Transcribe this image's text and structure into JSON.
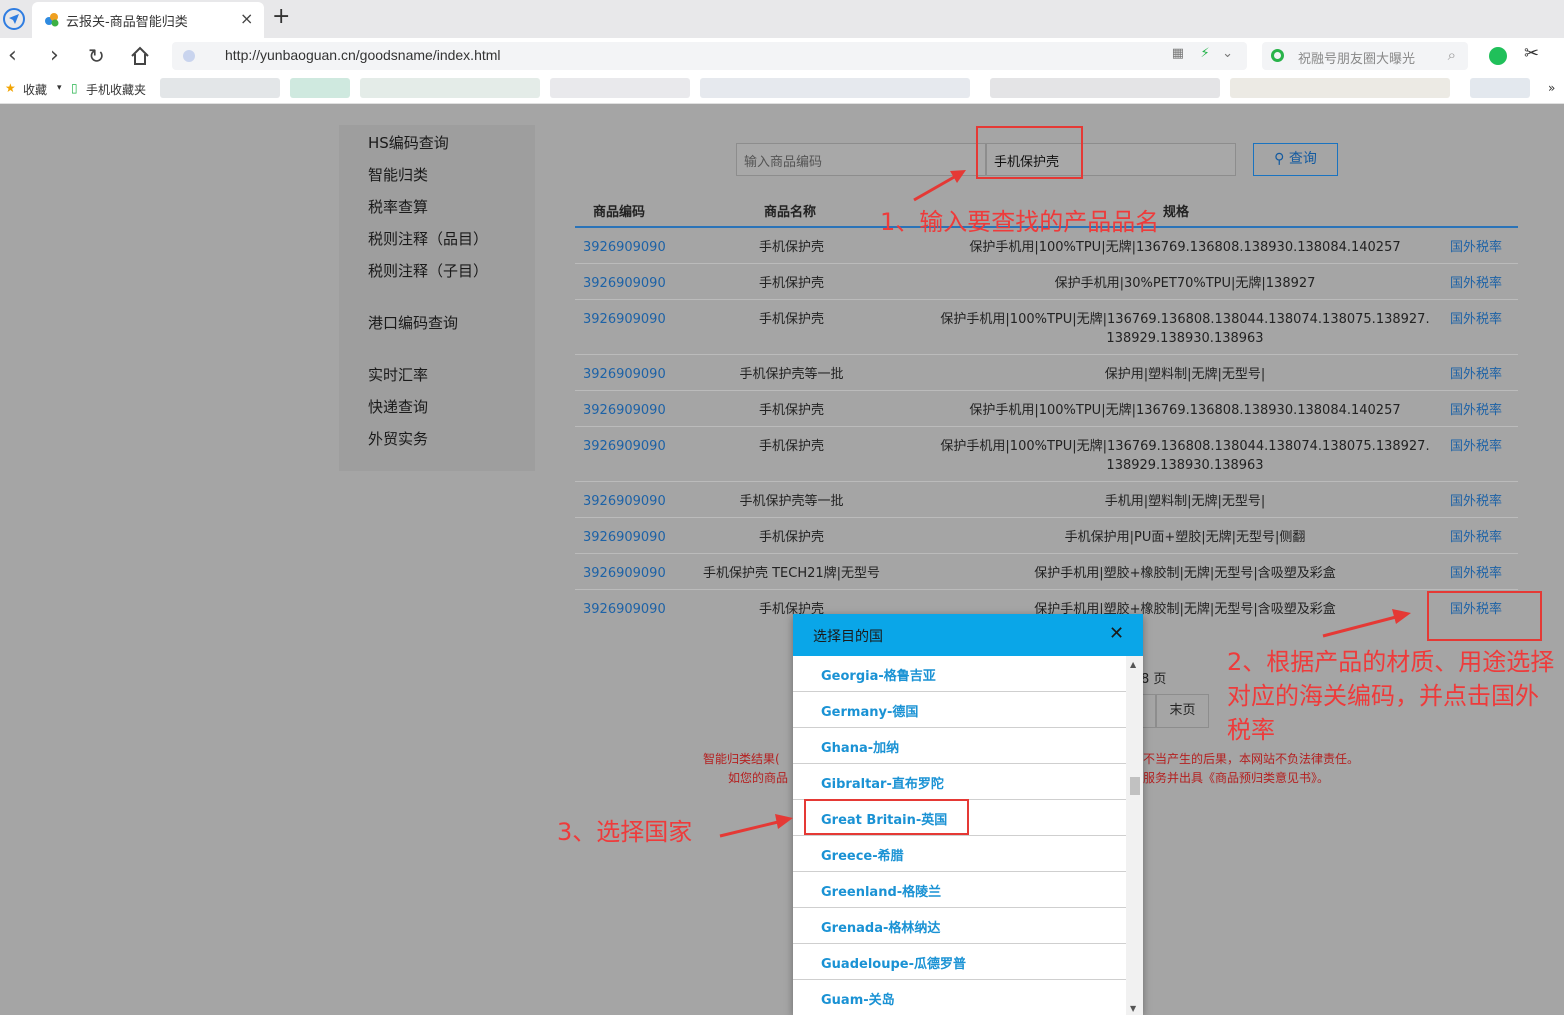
{
  "browser": {
    "tab_title": "云报关-商品智能归类",
    "tab_close": "×",
    "new_tab": "+",
    "url": "http://yunbaoguan.cn/goodsname/index.html",
    "search_placeholder": "祝融号朋友圈大曝光",
    "bookmarks": [
      {
        "label": "收藏"
      },
      {
        "label": "手机收藏夹"
      }
    ],
    "icons": [
      "back-icon",
      "forward-icon",
      "reload-icon",
      "home-icon",
      "shield-icon",
      "qr-icon",
      "lightning-icon",
      "chevron-down-icon",
      "search-icon",
      "extension-icon",
      "scissors-icon"
    ]
  },
  "sidebar": {
    "items": [
      {
        "label": "HS编码查询"
      },
      {
        "label": "智能归类"
      },
      {
        "label": "税率查算"
      },
      {
        "label": "税则注释（品目）"
      },
      {
        "label": "税则注释（子目）"
      },
      {
        "label": "港口编码查询"
      },
      {
        "label": "实时汇率"
      },
      {
        "label": "快递查询"
      },
      {
        "label": "外贸实务"
      }
    ]
  },
  "search": {
    "code_placeholder": "输入商品编码",
    "name_value": "手机保护壳",
    "button_label": "查询"
  },
  "table": {
    "headers": [
      "商品编码",
      "商品名称",
      "规格"
    ],
    "rows": [
      {
        "code": "3926909090",
        "name": "手机保护壳",
        "spec": "保护手机用|100%TPU|无牌|136769.136808.138930.138084.140257",
        "link": "国外税率"
      },
      {
        "code": "3926909090",
        "name": "手机保护壳",
        "spec": "保护手机用|30%PET70%TPU|无牌|138927",
        "link": "国外税率"
      },
      {
        "code": "3926909090",
        "name": "手机保护壳",
        "spec": "保护手机用|100%TPU|无牌|136769.136808.138044.138074.138075.138927.138929.138930.138963",
        "link": "国外税率"
      },
      {
        "code": "3926909090",
        "name": "手机保护壳等一批",
        "spec": "保护用|塑料制|无牌|无型号|",
        "link": "国外税率"
      },
      {
        "code": "3926909090",
        "name": "手机保护壳",
        "spec": "保护手机用|100%TPU|无牌|136769.136808.138930.138084.140257",
        "link": "国外税率"
      },
      {
        "code": "3926909090",
        "name": "手机保护壳",
        "spec": "保护手机用|100%TPU|无牌|136769.136808.138044.138074.138075.138927.138929.138930.138963",
        "link": "国外税率"
      },
      {
        "code": "3926909090",
        "name": "手机保护壳等一批",
        "spec": "手机用|塑料制|无牌|无型号|",
        "link": "国外税率"
      },
      {
        "code": "3926909090",
        "name": "手机保护壳",
        "spec": "手机保护用|PU面+塑胶|无牌|无型号|侧翻",
        "link": "国外税率"
      },
      {
        "code": "3926909090",
        "name": "手机保护壳 TECH21牌|无型号",
        "spec": "保护手机用|塑胶+橡胶制|无牌|无型号|含吸塑及彩盒",
        "link": "国外税率"
      },
      {
        "code": "3926909090",
        "name": "手机保护壳",
        "spec": "保护手机用|塑胶+橡胶制|无牌|无型号|含吸塑及彩盒",
        "link": "国外税率"
      }
    ]
  },
  "pager": {
    "pages_text": "8 页",
    "last_label": "末页"
  },
  "disclaimer": {
    "line1_left": "智能归类结果(",
    "line1_right": "不当产生的后果，本网站不负法律责任。",
    "line2_left": "如您的商品",
    "line2_right": "服务并出具《商品预归类意见书》。"
  },
  "annotations": {
    "step1": "1、输入要查找的产品品名",
    "step2": "2、根据产品的材质、用途选择对应的海关编码，并点击国外税率",
    "step3": "3、选择国家",
    "color": "#e53935"
  },
  "modal": {
    "title": "选择目的国",
    "close": "✕",
    "countries": [
      "Georgia-格鲁吉亚",
      "Germany-德国",
      "Ghana-加纳",
      "Gibraltar-直布罗陀",
      "Great Britain-英国",
      "Greece-希腊",
      "Greenland-格陵兰",
      "Grenada-格林纳达",
      "Guadeloupe-瓜德罗普",
      "Guam-关岛"
    ],
    "accent": "#0aa6e8"
  }
}
